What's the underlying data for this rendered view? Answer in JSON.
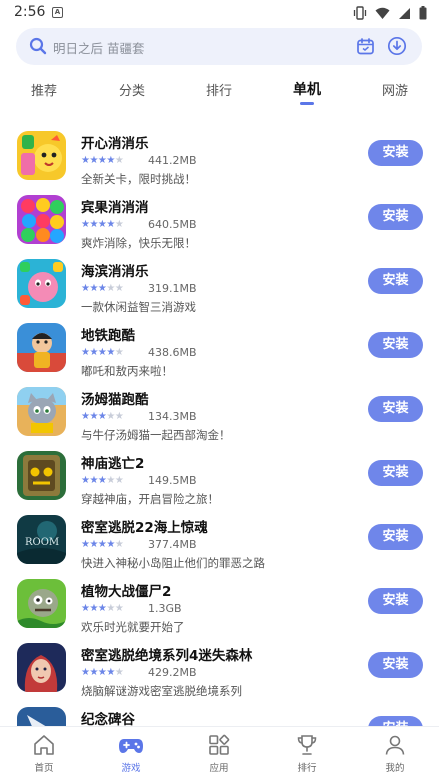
{
  "status_bar": {
    "time": "2:56",
    "notification_glyph": "A"
  },
  "search": {
    "placeholder": "明日之后 苗疆套"
  },
  "tabs": [
    {
      "label": "推荐",
      "active": false
    },
    {
      "label": "分类",
      "active": false
    },
    {
      "label": "排行",
      "active": false
    },
    {
      "label": "单机",
      "active": true
    },
    {
      "label": "网游",
      "active": false
    }
  ],
  "colors": {
    "accent": "#6f86ea",
    "star_on": "#6c86e8",
    "star_off": "#c8cdd9"
  },
  "apps": [
    {
      "name": "开心消消乐",
      "rating": 4.5,
      "stars": "★★★★",
      "stars_off": "★",
      "size": "441.2MB",
      "desc": "全新关卡，限时挑战！",
      "install_label": "安装",
      "icon": "happy-match-icon"
    },
    {
      "name": "宾果消消消",
      "rating": 4,
      "stars": "★★★★",
      "stars_off": "★",
      "size": "640.5MB",
      "desc": "爽炸消除，快乐无限！",
      "install_label": "安装",
      "icon": "bingo-match-icon"
    },
    {
      "name": "海滨消消乐",
      "rating": 3,
      "stars": "★★★",
      "stars_off": "★★",
      "size": "319.1MB",
      "desc": "一款休闲益智三消游戏",
      "install_label": "安装",
      "icon": "seaside-match-icon"
    },
    {
      "name": "地铁跑酷",
      "rating": 4.5,
      "stars": "★★★★",
      "stars_off": "★",
      "size": "438.6MB",
      "desc": "嘟吒和敖丙来啦！",
      "install_label": "安装",
      "icon": "subway-surfers-icon"
    },
    {
      "name": "汤姆猫跑酷",
      "rating": 3.5,
      "stars": "★★★",
      "stars_off": "★★",
      "size": "134.3MB",
      "desc": "与牛仔汤姆猫一起西部淘金！",
      "install_label": "安装",
      "icon": "tom-cat-run-icon"
    },
    {
      "name": "神庙逃亡2",
      "rating": 3,
      "stars": "★★★",
      "stars_off": "★★",
      "size": "149.5MB",
      "desc": "穿越神庙，开启冒险之旅！",
      "install_label": "安装",
      "icon": "temple-run-icon"
    },
    {
      "name": "密室逃脱22海上惊魂",
      "rating": 4,
      "stars": "★★★★",
      "stars_off": "★",
      "size": "377.4MB",
      "desc": "快进入神秘小岛阻止他们的罪恶之路",
      "install_label": "安装",
      "icon": "room-escape-22-icon"
    },
    {
      "name": "植物大战僵尸2",
      "rating": 3.5,
      "stars": "★★★",
      "stars_off": "★★",
      "size": "1.3GB",
      "desc": "欢乐时光就要开始了",
      "install_label": "安装",
      "icon": "plants-vs-zombies-icon"
    },
    {
      "name": "密室逃脱绝境系列4迷失森林",
      "rating": 4,
      "stars": "★★★★",
      "stars_off": "★",
      "size": "429.2MB",
      "desc": "烧脑解谜游戏密室逃脱绝境系列",
      "install_label": "安装",
      "icon": "lost-forest-icon"
    },
    {
      "name": "纪念碑谷",
      "rating": 0,
      "stars": "",
      "stars_off": "",
      "size": "",
      "desc": "",
      "install_label": "安装",
      "icon": "monument-valley-icon"
    }
  ],
  "bottom_nav": [
    {
      "label": "首页",
      "icon": "home-icon",
      "active": false
    },
    {
      "label": "游戏",
      "icon": "gamepad-icon",
      "active": true
    },
    {
      "label": "应用",
      "icon": "apps-grid-icon",
      "active": false
    },
    {
      "label": "排行",
      "icon": "trophy-icon",
      "active": false
    },
    {
      "label": "我的",
      "icon": "person-icon",
      "active": false
    }
  ]
}
